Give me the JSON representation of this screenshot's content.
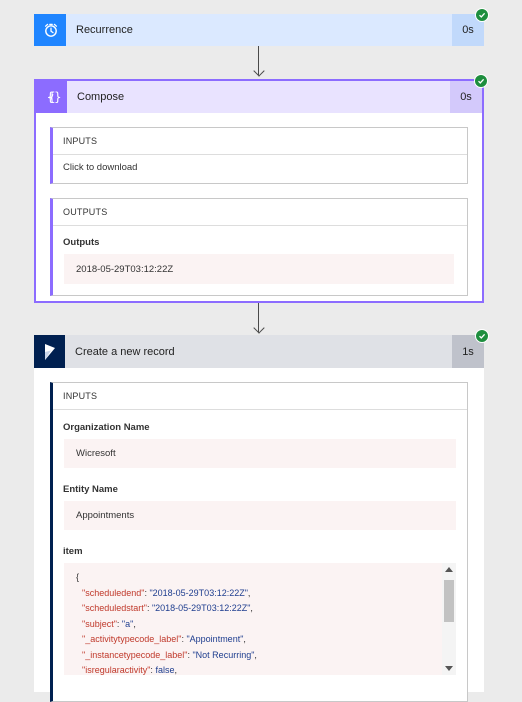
{
  "recurrence": {
    "title": "Recurrence",
    "duration": "0s",
    "icon": "alarm-clock-icon",
    "accent": "#1f85ff",
    "header_bg": "#dbe9ff",
    "duration_bg": "#c1d9fb"
  },
  "compose": {
    "title": "Compose",
    "duration": "0s",
    "icon": "curly-braces-function-icon",
    "accent": "#8c6cff",
    "header_bg": "#e9e3ff",
    "duration_bg": "#d3c9fb",
    "inputs": {
      "heading": "INPUTS",
      "value": "Click to download"
    },
    "outputs": {
      "heading": "OUTPUTS",
      "label": "Outputs",
      "value": "2018-05-29T03:12:22Z"
    }
  },
  "create_record": {
    "title": "Create a new record",
    "duration": "1s",
    "icon": "dynamics-365-icon",
    "accent": "#002050",
    "header_bg": "#dfe1e6",
    "duration_bg": "#bfc2cb",
    "inputs": {
      "heading": "INPUTS",
      "fields": [
        {
          "label": "Organization Name",
          "value": "Wicresoft"
        },
        {
          "label": "Entity Name",
          "value": "Appointments"
        }
      ],
      "item_label": "item",
      "item_json": {
        "open_brace": "{",
        "lines": [
          {
            "key": "\"scheduledend\"",
            "sep": ": ",
            "value": "\"2018-05-29T03:12:22Z\"",
            "end": ","
          },
          {
            "key": "\"scheduledstart\"",
            "sep": ": ",
            "value": "\"2018-05-29T03:12:22Z\"",
            "end": ","
          },
          {
            "key": "\"subject\"",
            "sep": ": ",
            "value": "\"a\"",
            "end": ","
          },
          {
            "key": "\"_activitytypecode_label\"",
            "sep": ": ",
            "value": "\"Appointment\"",
            "end": ","
          },
          {
            "key": "\"_instancetypecode_label\"",
            "sep": ": ",
            "value": "\"Not Recurring\"",
            "end": ","
          },
          {
            "key": "\"isregularactivity\"",
            "sep": ": ",
            "value": "false",
            "end": ","
          }
        ]
      }
    }
  },
  "status": {
    "success_color": "#1e8e3e"
  }
}
